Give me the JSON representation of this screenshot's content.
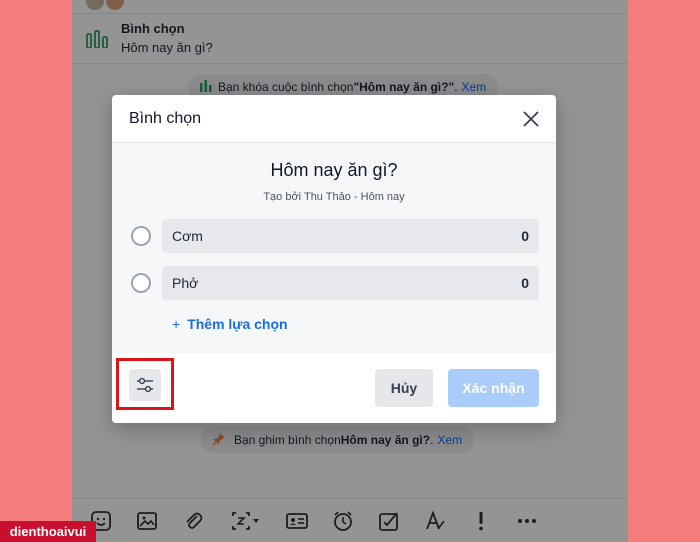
{
  "chat": {
    "poll_message": {
      "title": "Bình chọn",
      "question": "Hôm nay ăn gì?"
    },
    "lock_notice": {
      "prefix": "Bạn khóa cuộc bình chọn ",
      "poll_name": "\"Hôm nay ăn gì?\"",
      "suffix": ".",
      "link": "Xem"
    },
    "pin_notice": {
      "prefix": "Bạn ghim bình chọn ",
      "poll_name": "Hôm nay ăn gì?",
      "suffix": " .",
      "link": "Xem"
    },
    "toolbar_icons": [
      "sticker-icon",
      "image-icon",
      "attachment-icon",
      "screenshot-icon",
      "contact-card-icon",
      "reminder-icon",
      "task-icon",
      "text-format-icon",
      "important-icon",
      "more-icon"
    ]
  },
  "modal": {
    "title": "Bình chọn",
    "question": "Hôm nay ăn gì?",
    "creator": "Tạo bởi Thu Thảo - Hôm nay",
    "options": [
      {
        "label": "Cơm",
        "count": "0"
      },
      {
        "label": "Phở",
        "count": "0"
      }
    ],
    "add_option": "Thêm lựa chọn",
    "cancel_label": "Hủy",
    "confirm_label": "Xác nhận"
  },
  "watermark": "dienthoaivui",
  "colors": {
    "background": "#f47c7c",
    "accent": "#0068ff",
    "confirm_disabled": "#a9ccfa",
    "highlight": "#d9151b",
    "poll_icon": "#2e9e63"
  }
}
